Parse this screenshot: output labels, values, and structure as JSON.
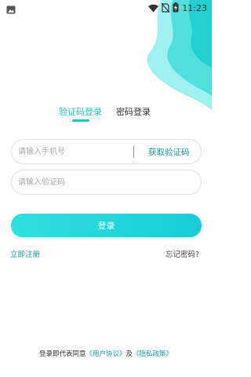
{
  "status_bar": {
    "time": "11:23",
    "icons": [
      "image-icon",
      "wifi-icon",
      "no-sim-icon",
      "battery-charging-icon"
    ]
  },
  "colors": {
    "accent": "#1ec6c7",
    "link": "#1a9fa5",
    "button_gradient_start": "#2ee0dd",
    "button_gradient_end": "#17cdd7",
    "blob_light": "#7eecea",
    "blob_dark": "#22d0d2"
  },
  "tabs": {
    "active_label": "验证码登录",
    "inactive_label": "密码登录"
  },
  "form": {
    "phone_placeholder": "请输入手机号",
    "get_code_label": "获取验证码",
    "code_placeholder": "请输入验证码",
    "login_label": "登录"
  },
  "links": {
    "register": "立即注册",
    "forgot": "忘记密码?"
  },
  "agreement": {
    "prefix": "登录即代表同意",
    "user_agreement": "《用户协议》",
    "and": "及",
    "privacy_policy": "《隐私政策》"
  }
}
